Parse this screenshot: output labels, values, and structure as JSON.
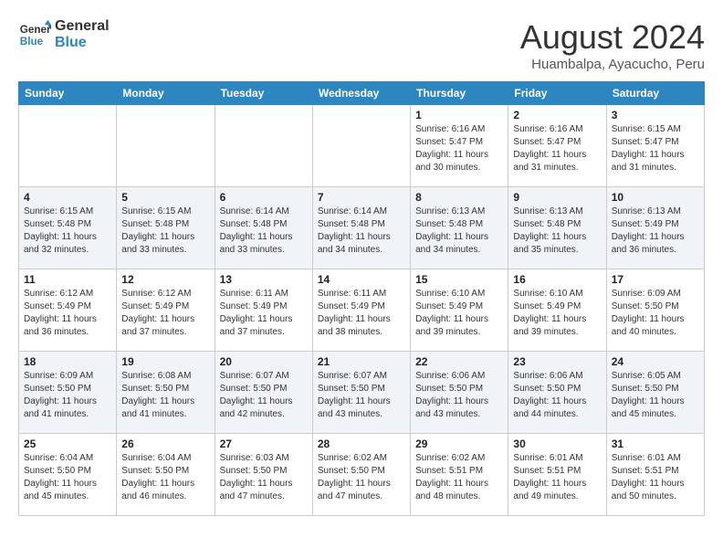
{
  "header": {
    "logo_line1": "General",
    "logo_line2": "Blue",
    "month": "August 2024",
    "location": "Huambalpa, Ayacucho, Peru"
  },
  "weekdays": [
    "Sunday",
    "Monday",
    "Tuesday",
    "Wednesday",
    "Thursday",
    "Friday",
    "Saturday"
  ],
  "weeks": [
    [
      {
        "day": "",
        "info": ""
      },
      {
        "day": "",
        "info": ""
      },
      {
        "day": "",
        "info": ""
      },
      {
        "day": "",
        "info": ""
      },
      {
        "day": "1",
        "info": "Sunrise: 6:16 AM\nSunset: 5:47 PM\nDaylight: 11 hours\nand 30 minutes."
      },
      {
        "day": "2",
        "info": "Sunrise: 6:16 AM\nSunset: 5:47 PM\nDaylight: 11 hours\nand 31 minutes."
      },
      {
        "day": "3",
        "info": "Sunrise: 6:15 AM\nSunset: 5:47 PM\nDaylight: 11 hours\nand 31 minutes."
      }
    ],
    [
      {
        "day": "4",
        "info": "Sunrise: 6:15 AM\nSunset: 5:48 PM\nDaylight: 11 hours\nand 32 minutes."
      },
      {
        "day": "5",
        "info": "Sunrise: 6:15 AM\nSunset: 5:48 PM\nDaylight: 11 hours\nand 33 minutes."
      },
      {
        "day": "6",
        "info": "Sunrise: 6:14 AM\nSunset: 5:48 PM\nDaylight: 11 hours\nand 33 minutes."
      },
      {
        "day": "7",
        "info": "Sunrise: 6:14 AM\nSunset: 5:48 PM\nDaylight: 11 hours\nand 34 minutes."
      },
      {
        "day": "8",
        "info": "Sunrise: 6:13 AM\nSunset: 5:48 PM\nDaylight: 11 hours\nand 34 minutes."
      },
      {
        "day": "9",
        "info": "Sunrise: 6:13 AM\nSunset: 5:48 PM\nDaylight: 11 hours\nand 35 minutes."
      },
      {
        "day": "10",
        "info": "Sunrise: 6:13 AM\nSunset: 5:49 PM\nDaylight: 11 hours\nand 36 minutes."
      }
    ],
    [
      {
        "day": "11",
        "info": "Sunrise: 6:12 AM\nSunset: 5:49 PM\nDaylight: 11 hours\nand 36 minutes."
      },
      {
        "day": "12",
        "info": "Sunrise: 6:12 AM\nSunset: 5:49 PM\nDaylight: 11 hours\nand 37 minutes."
      },
      {
        "day": "13",
        "info": "Sunrise: 6:11 AM\nSunset: 5:49 PM\nDaylight: 11 hours\nand 37 minutes."
      },
      {
        "day": "14",
        "info": "Sunrise: 6:11 AM\nSunset: 5:49 PM\nDaylight: 11 hours\nand 38 minutes."
      },
      {
        "day": "15",
        "info": "Sunrise: 6:10 AM\nSunset: 5:49 PM\nDaylight: 11 hours\nand 39 minutes."
      },
      {
        "day": "16",
        "info": "Sunrise: 6:10 AM\nSunset: 5:49 PM\nDaylight: 11 hours\nand 39 minutes."
      },
      {
        "day": "17",
        "info": "Sunrise: 6:09 AM\nSunset: 5:50 PM\nDaylight: 11 hours\nand 40 minutes."
      }
    ],
    [
      {
        "day": "18",
        "info": "Sunrise: 6:09 AM\nSunset: 5:50 PM\nDaylight: 11 hours\nand 41 minutes."
      },
      {
        "day": "19",
        "info": "Sunrise: 6:08 AM\nSunset: 5:50 PM\nDaylight: 11 hours\nand 41 minutes."
      },
      {
        "day": "20",
        "info": "Sunrise: 6:07 AM\nSunset: 5:50 PM\nDaylight: 11 hours\nand 42 minutes."
      },
      {
        "day": "21",
        "info": "Sunrise: 6:07 AM\nSunset: 5:50 PM\nDaylight: 11 hours\nand 43 minutes."
      },
      {
        "day": "22",
        "info": "Sunrise: 6:06 AM\nSunset: 5:50 PM\nDaylight: 11 hours\nand 43 minutes."
      },
      {
        "day": "23",
        "info": "Sunrise: 6:06 AM\nSunset: 5:50 PM\nDaylight: 11 hours\nand 44 minutes."
      },
      {
        "day": "24",
        "info": "Sunrise: 6:05 AM\nSunset: 5:50 PM\nDaylight: 11 hours\nand 45 minutes."
      }
    ],
    [
      {
        "day": "25",
        "info": "Sunrise: 6:04 AM\nSunset: 5:50 PM\nDaylight: 11 hours\nand 45 minutes."
      },
      {
        "day": "26",
        "info": "Sunrise: 6:04 AM\nSunset: 5:50 PM\nDaylight: 11 hours\nand 46 minutes."
      },
      {
        "day": "27",
        "info": "Sunrise: 6:03 AM\nSunset: 5:50 PM\nDaylight: 11 hours\nand 47 minutes."
      },
      {
        "day": "28",
        "info": "Sunrise: 6:02 AM\nSunset: 5:50 PM\nDaylight: 11 hours\nand 47 minutes."
      },
      {
        "day": "29",
        "info": "Sunrise: 6:02 AM\nSunset: 5:51 PM\nDaylight: 11 hours\nand 48 minutes."
      },
      {
        "day": "30",
        "info": "Sunrise: 6:01 AM\nSunset: 5:51 PM\nDaylight: 11 hours\nand 49 minutes."
      },
      {
        "day": "31",
        "info": "Sunrise: 6:01 AM\nSunset: 5:51 PM\nDaylight: 11 hours\nand 50 minutes."
      }
    ]
  ]
}
